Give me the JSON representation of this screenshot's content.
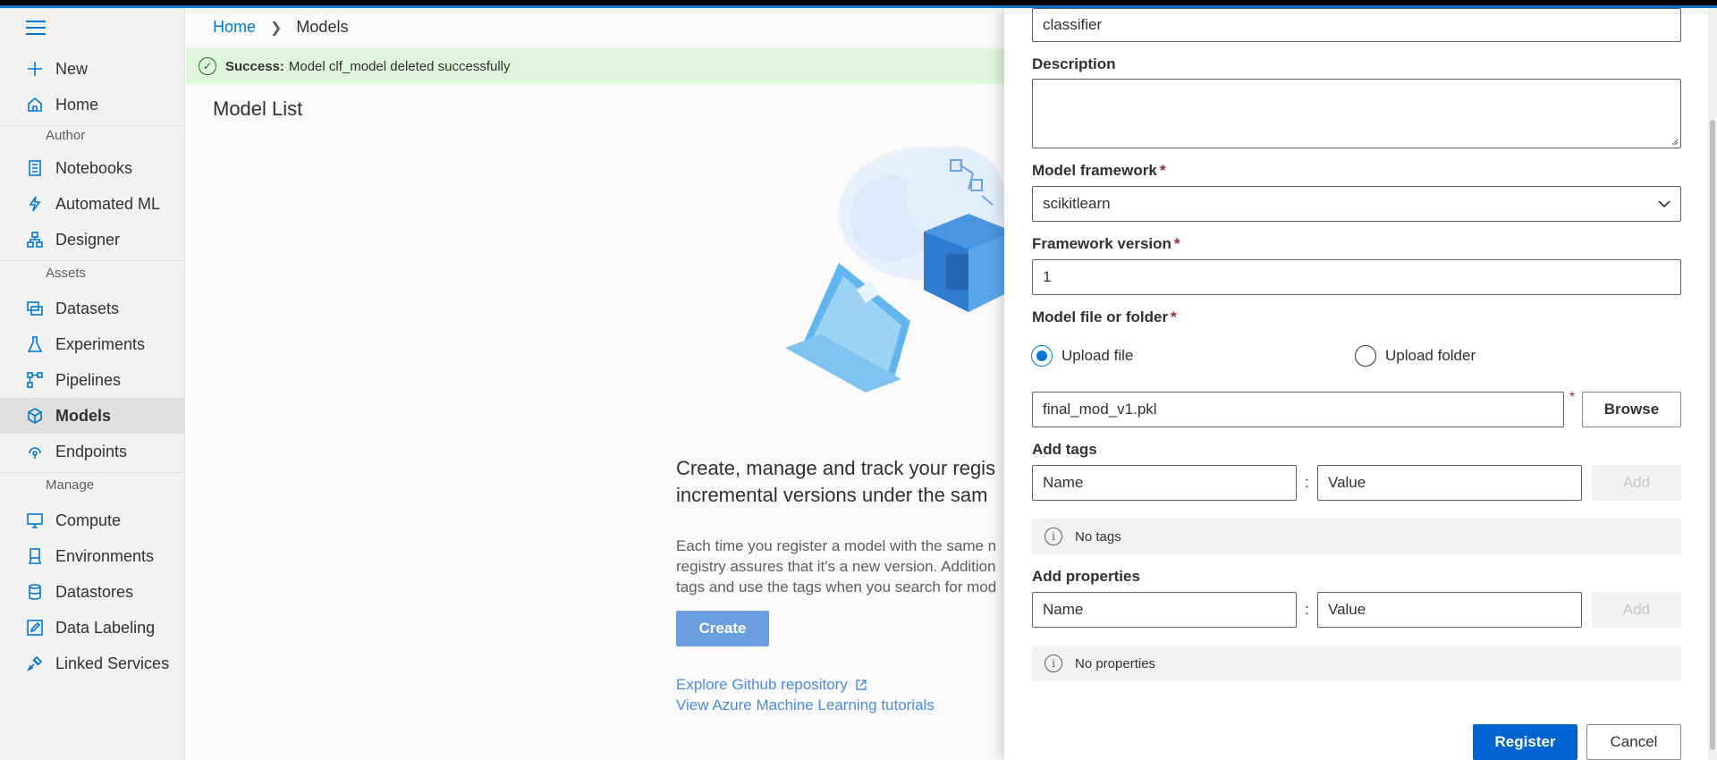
{
  "sidebar": {
    "items": [
      {
        "label": "New",
        "icon": "plus-icon"
      },
      {
        "label": "Home",
        "icon": "home-icon"
      },
      {
        "label": "Notebooks",
        "icon": "notebook-icon"
      },
      {
        "label": "Automated ML",
        "icon": "automl-icon"
      },
      {
        "label": "Designer",
        "icon": "designer-icon"
      },
      {
        "label": "Datasets",
        "icon": "datasets-icon"
      },
      {
        "label": "Experiments",
        "icon": "flask-icon"
      },
      {
        "label": "Pipelines",
        "icon": "pipeline-icon"
      },
      {
        "label": "Models",
        "icon": "cube-icon",
        "active": true
      },
      {
        "label": "Endpoints",
        "icon": "endpoint-icon"
      },
      {
        "label": "Compute",
        "icon": "monitor-icon"
      },
      {
        "label": "Environments",
        "icon": "environment-icon"
      },
      {
        "label": "Datastores",
        "icon": "database-icon"
      },
      {
        "label": "Data Labeling",
        "icon": "label-edit-icon"
      },
      {
        "label": "Linked Services",
        "icon": "linked-services-icon"
      }
    ],
    "sections": [
      "Author",
      "Assets",
      "Manage"
    ]
  },
  "breadcrumb": {
    "home": "Home",
    "current": "Models"
  },
  "notification": {
    "prefix": "Success:",
    "message": "Model clf_model deleted successfully"
  },
  "main": {
    "title": "Model List",
    "hero_line1": "Create, manage and track your regis",
    "hero_line2": "incremental versions under the sam",
    "body_line1": "Each time you register a model with the same n",
    "body_line2": "registry assures that it's a new version. Addition",
    "body_line3": "tags and use the tags when you search for mod",
    "create_label": "Create",
    "link_github": "Explore Github repository",
    "link_tutorials": "View Azure Machine Learning tutorials"
  },
  "panel": {
    "name_value": "classifier",
    "description_label": "Description",
    "description_value": "",
    "framework_label": "Model framework",
    "framework_value": "scikitlearn",
    "framework_version_label": "Framework version",
    "framework_version_value": "1",
    "file_label": "Model file or folder",
    "upload_file_label": "Upload file",
    "upload_folder_label": "Upload folder",
    "file_value": "final_mod_v1.pkl",
    "browse_label": "Browse",
    "tags_label": "Add tags",
    "tag_name_placeholder": "Name",
    "tag_value_placeholder": "Value",
    "add_label": "Add",
    "no_tags": "No tags",
    "properties_label": "Add properties",
    "prop_name_placeholder": "Name",
    "prop_value_placeholder": "Value",
    "no_properties": "No properties",
    "register_label": "Register",
    "cancel_label": "Cancel",
    "required_mark": "*",
    "separator": ":"
  }
}
